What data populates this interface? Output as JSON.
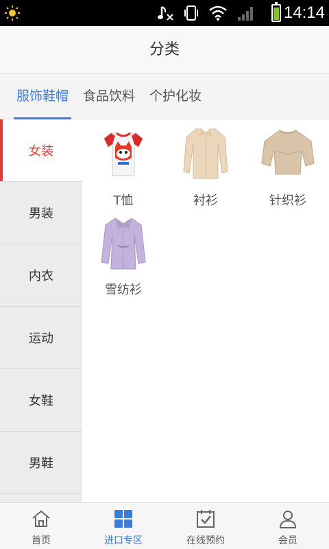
{
  "status_bar": {
    "time": "14:14",
    "battery_level": 0.8
  },
  "header": {
    "title": "分类"
  },
  "top_tabs": [
    {
      "label": "服饰鞋帽",
      "active": true
    },
    {
      "label": "食品饮料",
      "active": false
    },
    {
      "label": "个护化妆",
      "active": false
    }
  ],
  "sidebar": {
    "items": [
      {
        "label": "女装",
        "active": true
      },
      {
        "label": "男装",
        "active": false
      },
      {
        "label": "内衣",
        "active": false
      },
      {
        "label": "运动",
        "active": false
      },
      {
        "label": "女鞋",
        "active": false
      },
      {
        "label": "男鞋",
        "active": false
      }
    ]
  },
  "grid": {
    "items": [
      {
        "label": "T恤",
        "icon": "tshirt-icon"
      },
      {
        "label": "衬衫",
        "icon": "shirt-icon"
      },
      {
        "label": "针织衫",
        "icon": "knit-top-icon"
      },
      {
        "label": "雪纺衫",
        "icon": "chiffon-blouse-icon"
      }
    ]
  },
  "bottom_nav": [
    {
      "label": "首页",
      "icon": "home-icon",
      "active": false
    },
    {
      "label": "进口专区",
      "icon": "grid-icon",
      "active": true
    },
    {
      "label": "在线预约",
      "icon": "calendar-check-icon",
      "active": false
    },
    {
      "label": "会员",
      "icon": "user-icon",
      "active": false
    }
  ],
  "colors": {
    "accent": "#3a7be0",
    "sidebar_active": "#e53935",
    "status_bar": "#000000"
  }
}
